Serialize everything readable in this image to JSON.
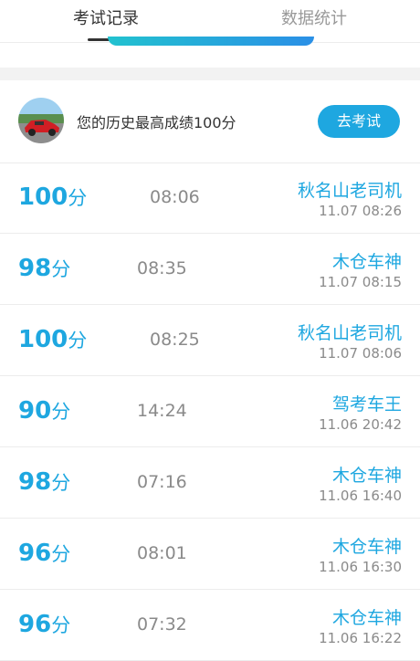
{
  "tabs": {
    "active_label": "考试记录",
    "inactive_label": "数据统计"
  },
  "best": {
    "text": "您的历史最高成绩100分",
    "button_label": "去考试"
  },
  "records": [
    {
      "score": "100",
      "unit": "分",
      "duration": "08:06",
      "name": "秋名山老司机",
      "date": "11.07  08:26"
    },
    {
      "score": "98",
      "unit": "分",
      "duration": "08:35",
      "name": "木仓车神",
      "date": "11.07  08:15"
    },
    {
      "score": "100",
      "unit": "分",
      "duration": "08:25",
      "name": "秋名山老司机",
      "date": "11.07  08:06"
    },
    {
      "score": "90",
      "unit": "分",
      "duration": "14:24",
      "name": "驾考车王",
      "date": "11.06  20:42"
    },
    {
      "score": "98",
      "unit": "分",
      "duration": "07:16",
      "name": "木仓车神",
      "date": "11.06  16:40"
    },
    {
      "score": "96",
      "unit": "分",
      "duration": "08:01",
      "name": "木仓车神",
      "date": "11.06  16:30"
    },
    {
      "score": "96",
      "unit": "分",
      "duration": "07:32",
      "name": "木仓车神",
      "date": "11.06  16:22"
    }
  ],
  "colors": {
    "accent": "#1ea7e0",
    "muted": "#8a8a8a"
  }
}
